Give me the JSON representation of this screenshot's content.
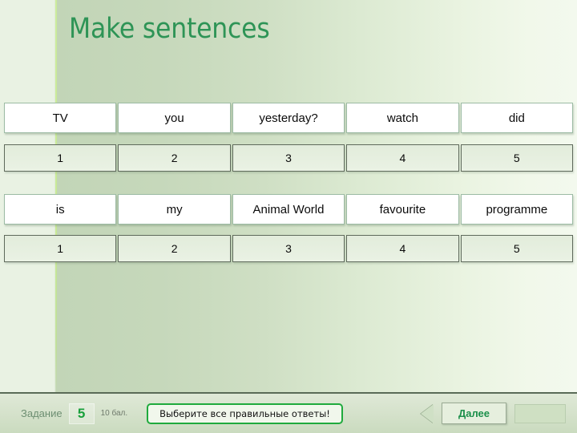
{
  "slide": {
    "title": "Make sentences"
  },
  "exercises": [
    {
      "words": [
        "TV",
        "you",
        "yesterday?",
        "watch",
        "did"
      ],
      "numbers": [
        "1",
        "2",
        "3",
        "4",
        "5"
      ]
    },
    {
      "words": [
        "is",
        "my",
        "Animal World",
        "favourite",
        "programme"
      ],
      "numbers": [
        "1",
        "2",
        "3",
        "4",
        "5"
      ]
    }
  ],
  "footer": {
    "task_label": "Задание",
    "task_number": "5",
    "task_points": "10 бал.",
    "instruction": "Выберите все правильные ответы!",
    "next_label": "Далее"
  },
  "colors": {
    "title_green": "#2e9456",
    "accent_green": "#1faa3d",
    "task_number_green": "#19a03c",
    "background_left": "#c2d5b7",
    "background_right": "#f3f9ee"
  }
}
